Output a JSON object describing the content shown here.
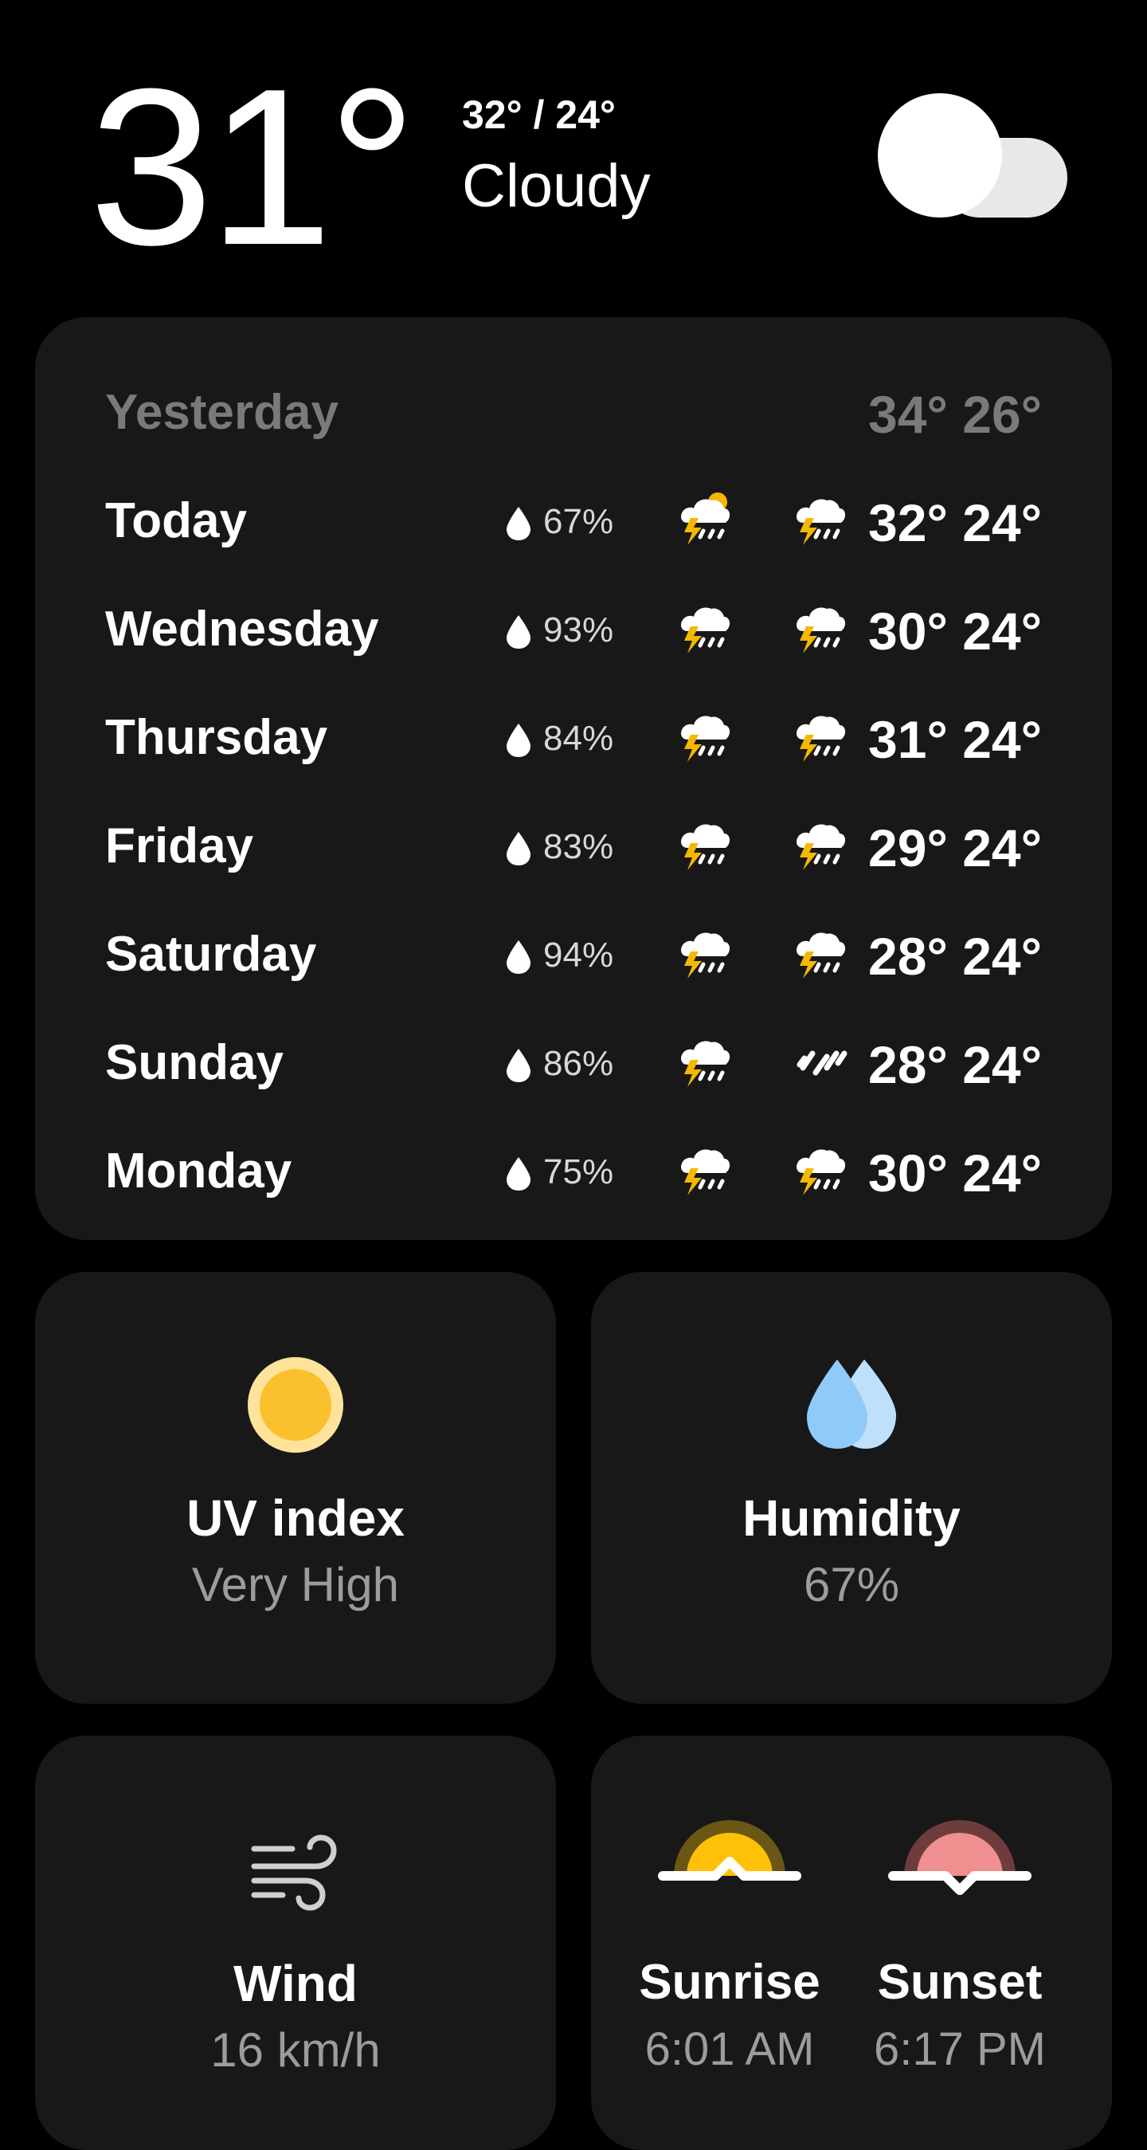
{
  "current": {
    "temp": "31°",
    "hilo": "32° / 24°",
    "condition": "Cloudy"
  },
  "forecast": {
    "yesterday": {
      "day": "Yesterday",
      "temps": "34° 26°"
    },
    "rows": [
      {
        "day": "Today",
        "precip": "67%",
        "day_icon": "thunder-sun-icon",
        "night_icon": "thunderstorm-icon",
        "temps": "32° 24°"
      },
      {
        "day": "Wednesday",
        "precip": "93%",
        "day_icon": "thunderstorm-icon",
        "night_icon": "thunderstorm-icon",
        "temps": "30° 24°"
      },
      {
        "day": "Thursday",
        "precip": "84%",
        "day_icon": "thunderstorm-icon",
        "night_icon": "thunderstorm-icon",
        "temps": "31° 24°"
      },
      {
        "day": "Friday",
        "precip": "83%",
        "day_icon": "thunderstorm-icon",
        "night_icon": "thunderstorm-icon",
        "temps": "29° 24°"
      },
      {
        "day": "Saturday",
        "precip": "94%",
        "day_icon": "thunderstorm-icon",
        "night_icon": "thunderstorm-icon",
        "temps": "28° 24°"
      },
      {
        "day": "Sunday",
        "precip": "86%",
        "day_icon": "thunderstorm-icon",
        "night_icon": "rain-icon",
        "temps": "28° 24°"
      },
      {
        "day": "Monday",
        "precip": "75%",
        "day_icon": "thunderstorm-icon",
        "night_icon": "thunderstorm-icon",
        "temps": "30° 24°"
      }
    ]
  },
  "tiles": {
    "uv": {
      "title": "UV index",
      "value": "Very High"
    },
    "humidity": {
      "title": "Humidity",
      "value": "67%"
    },
    "wind": {
      "title": "Wind",
      "value": "16 km/h"
    },
    "sunrise": {
      "title": "Sunrise",
      "value": "6:01 AM"
    },
    "sunset": {
      "title": "Sunset",
      "value": "6:17 PM"
    }
  },
  "colors": {
    "background": "#000000",
    "card": "#181818",
    "bolt": "#f5b800",
    "uv_sun": "#fbc02d",
    "humidity_drop": "#90caf9",
    "sunrise": "#ffc107",
    "sunset": "#ef8f8f"
  }
}
